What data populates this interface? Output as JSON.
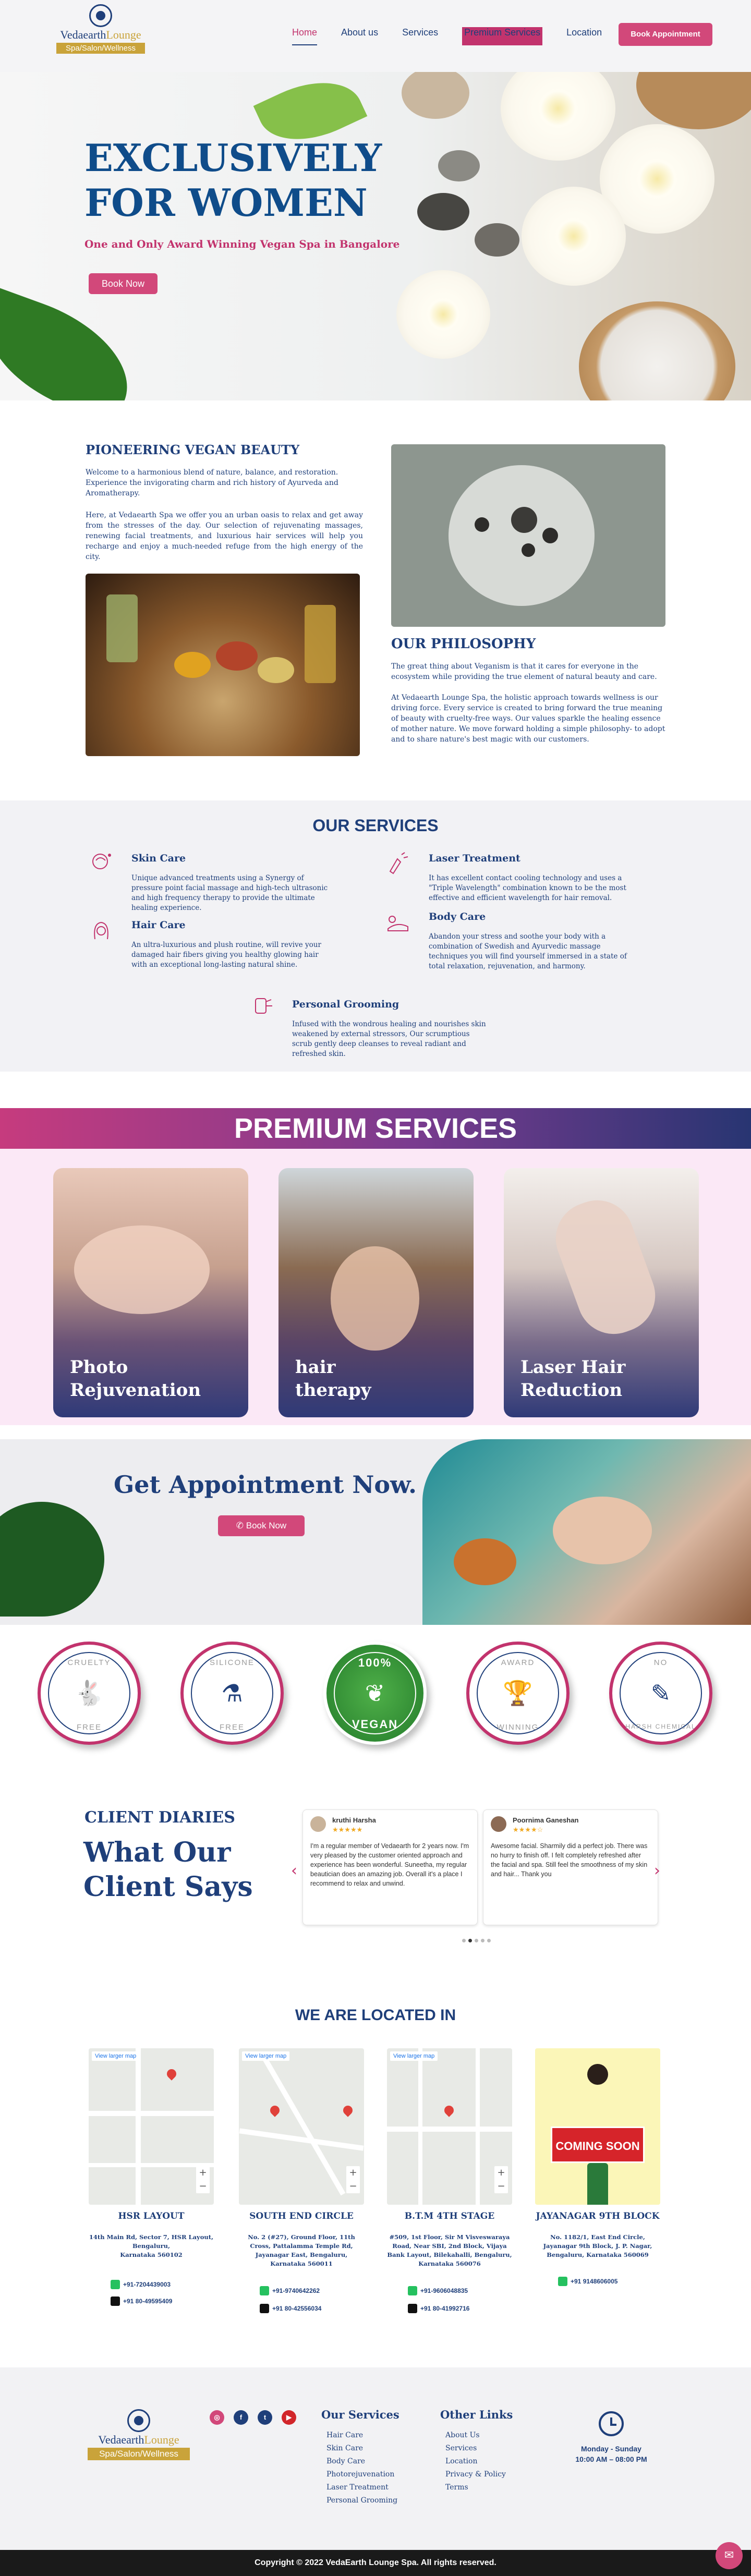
{
  "brand": {
    "name_main": "Vedaearth",
    "name_accent": "Lounge",
    "tagline": "Spa/Salon/Wellness",
    "colors": {
      "navy": "#1f3f7a",
      "pink": "#c2336d",
      "gold": "#c9a33a"
    }
  },
  "nav": {
    "links": [
      "Home",
      "About us",
      "Services",
      "Premium Services",
      "Location"
    ],
    "book_label": "Book Appointment"
  },
  "hero": {
    "title_line1": "EXCLUSIVELY",
    "title_line2": "FOR WOMEN",
    "subtitle": "One and Only Award Winning Vegan Spa in Bangalore",
    "button": "Book Now"
  },
  "vegan": {
    "heading": "PIONEERING VEGAN BEAUTY",
    "para1": "Welcome to a harmonious blend of nature, balance, and restoration. Experience the invigorating charm and rich history of Ayurveda and Aromatherapy.",
    "para2": "Here, at Vedaearth Spa we offer you an urban oasis to relax and get away from the stresses of the day. Our selection of rejuvenating massages, renewing facial treatments, and luxurious hair services will help you recharge and enjoy a much-needed refuge from the high energy of the city."
  },
  "philosophy": {
    "heading": "OUR PHILOSOPHY",
    "para1": "The great thing about Veganism is that it cares for everyone in the ecosystem while providing the true element of natural beauty and care.",
    "para2": "At Vedaearth Lounge Spa, the holistic approach towards wellness is our driving force. Every service is created to bring forward the true meaning of beauty with cruelty-free ways. Our values sparkle the healing essence of mother nature. We move forward holding a simple philosophy- to adopt and to share nature's best magic with our customers."
  },
  "services": {
    "heading": "OUR SERVICES",
    "items": [
      {
        "title": "Skin Care",
        "desc": "Unique advanced treatments using a Synergy of pressure point facial massage and high-tech ultrasonic and high frequency therapy to provide the ultimate healing experience.",
        "icon": "face-icon"
      },
      {
        "title": "Laser Treatment",
        "desc": "It has excellent contact cooling technology and uses a \"Triple Wavelength\" combination known to be the most effective and efficient wavelength for hair removal.",
        "icon": "laser-icon"
      },
      {
        "title": "Hair Care",
        "desc": "An ultra-luxurious and plush routine, will revive your damaged hair fibers giving you healthy glowing hair with an exceptional long-lasting natural shine.",
        "icon": "hair-icon"
      },
      {
        "title": "Body Care",
        "desc": "Abandon your stress and soothe your body with a combination of Swedish and Ayurvedic massage techniques you will find yourself immersed in a state of total relaxation, rejuvenation, and harmony.",
        "icon": "body-icon"
      },
      {
        "title": "Personal Grooming",
        "desc": "Infused with the wondrous healing and nourishes skin weakened by external stressors, Our scrumptious scrub gently deep cleanses to reveal radiant and refreshed skin.",
        "icon": "grooming-icon"
      }
    ]
  },
  "premium": {
    "banner": "PREMIUM SERVICES",
    "cards": [
      {
        "line1": "Photo",
        "line2": "Rejuvenation"
      },
      {
        "line1": "hair",
        "line2": "therapy"
      },
      {
        "line1": "Laser Hair",
        "line2": "Reduction"
      }
    ]
  },
  "appointment": {
    "heading": "Get Appointment Now.",
    "button": "Book Now"
  },
  "badges": [
    {
      "top": "CRUELTY",
      "bottom": "FREE",
      "icon": "rabbit-icon"
    },
    {
      "top": "SILICONE",
      "bottom": "FREE",
      "icon": "flask-icon"
    },
    {
      "top": "100%",
      "bottom": "VEGAN",
      "icon": "leaf-icon"
    },
    {
      "top": "AWARD",
      "bottom": "WINNING",
      "icon": "trophy-icon"
    },
    {
      "top": "NO",
      "bottom": "HARSH CHEMICAL",
      "icon": "dropper-icon"
    }
  ],
  "testimonials": {
    "kicker": "CLIENT DIARIES",
    "heading_line1": "What Our",
    "heading_line2": "Client Says",
    "reviews": [
      {
        "name": "kruthi Harsha",
        "stars": "★★★★★",
        "text": "I'm a regular member of Vedaearth for 2 years now. I'm very pleased by the customer oriented approach and experience has been wonderful. Suneetha, my regular beautician does an amazing job. Overall it's a place I recommend to relax and unwind."
      },
      {
        "name": "Poornima Ganeshan",
        "stars": "★★★★☆",
        "text": "Awesome facial. Sharmily did a perfect job. There was no hurry to finish off. I felt completely refreshed after the facial and spa. Still feel the smoothness of my skin and hair... Thank you"
      }
    ]
  },
  "locations": {
    "heading": "WE ARE LOCATED IN",
    "map_link": "View larger map",
    "coming_soon": "COMING SOON",
    "items": [
      {
        "name": "HSR LAYOUT",
        "addr1": "14th Main Rd, Sector 7, HSR Layout,",
        "addr2": "Bengaluru,",
        "addr3": "Karnataka 560102",
        "addr4": "",
        "wa": "+91-7204439003",
        "call": "+91 80-49595409"
      },
      {
        "name": "SOUTH END CIRCLE",
        "addr1": "No. 2 (#27), Ground Floor, 11th",
        "addr2": "Cross, Pattalamma Temple Rd,",
        "addr3": "Jayanagar East, Bengaluru,",
        "addr4": "Karnataka 560011",
        "wa": "+91-9740642262",
        "call": "+91 80-42556034"
      },
      {
        "name": "B.T.M 4TH STAGE",
        "addr1": "#509, 1st Floor, Sir M Visveswaraya",
        "addr2": "Road, Near SBI, 2nd Block, Vijaya",
        "addr3": "Bank Layout, Bilekahalli, Bengaluru,",
        "addr4": "Karnataka 560076",
        "wa": "+91-9606048835",
        "call": "+91 80-41992716"
      },
      {
        "name": "JAYANAGAR 9TH BLOCK",
        "addr1": "No. 1182/1, East End Circle,",
        "addr2": "Jayanagar 9th Block, J. P. Nagar,",
        "addr3": "Bengaluru, Karnataka 560069",
        "addr4": "",
        "wa": "+91 9148606005",
        "call": ""
      }
    ]
  },
  "footer": {
    "services_heading": "Our Services",
    "services": [
      "Hair Care",
      "Skin Care",
      "Body Care",
      "Photorejuvenation",
      "Laser Treatment",
      "Personal Grooming"
    ],
    "links_heading": "Other Links",
    "links": [
      "About Us",
      "Services",
      "Location",
      "Privacy & Policy",
      "Terms"
    ],
    "hours_days": "Monday - Sunday",
    "hours_time": "10:00 AM – 08:00 PM",
    "social": [
      "instagram-icon",
      "facebook-icon",
      "twitter-icon",
      "youtube-icon"
    ],
    "copyright": "Copyright © 2022 VedaEarth Lounge Spa. All rights reserved."
  }
}
